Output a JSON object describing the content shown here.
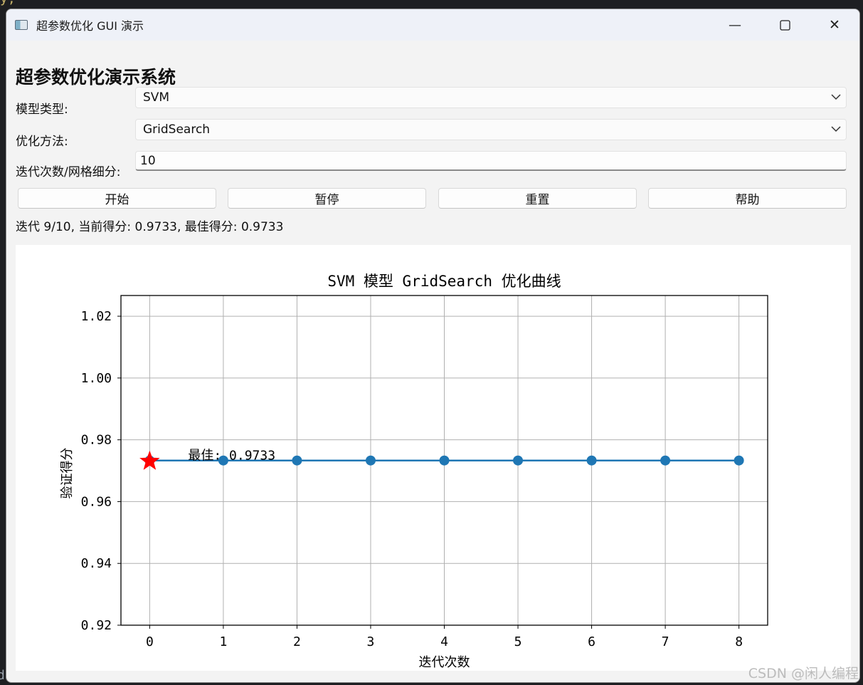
{
  "window": {
    "title": "超参数优化 GUI 演示",
    "minimize_glyph": "—",
    "close_glyph": "✕"
  },
  "heading": "超参数优化演示系统",
  "form": {
    "model_label": "模型类型:",
    "model_value": "SVM",
    "method_label": "优化方法:",
    "method_value": "GridSearch",
    "iter_label": "迭代次数/网格细分:",
    "iter_value": "10"
  },
  "buttons": {
    "start": "开始",
    "pause": "暂停",
    "reset": "重置",
    "help": "帮助"
  },
  "status": "迭代 9/10, 当前得分: 0.9733, 最佳得分: 0.9733",
  "watermark": "CSDN @闲人编程",
  "chart_data": {
    "type": "line",
    "title": "SVM 模型 GridSearch 优化曲线",
    "xlabel": "迭代次数",
    "ylabel": "验证得分",
    "x": [
      0,
      1,
      2,
      3,
      4,
      5,
      6,
      7,
      8
    ],
    "series": [
      {
        "values": [
          0.9733,
          0.9733,
          0.9733,
          0.9733,
          0.9733,
          0.9733,
          0.9733,
          0.9733,
          0.9733
        ]
      }
    ],
    "xticks": [
      "0",
      "1",
      "2",
      "3",
      "4",
      "5",
      "6",
      "7",
      "8"
    ],
    "yticks": [
      "0.92",
      "0.94",
      "0.96",
      "0.98",
      "1.00",
      "1.02"
    ],
    "xlim": [
      -0.39,
      8.39
    ],
    "ylim": [
      0.92,
      1.0267
    ],
    "grid": true,
    "best_marker": {
      "x": 0,
      "y": 0.9733,
      "label": "最佳: 0.9733"
    },
    "colors": {
      "line": "#1f77b4",
      "best": "#ff0000"
    }
  }
}
